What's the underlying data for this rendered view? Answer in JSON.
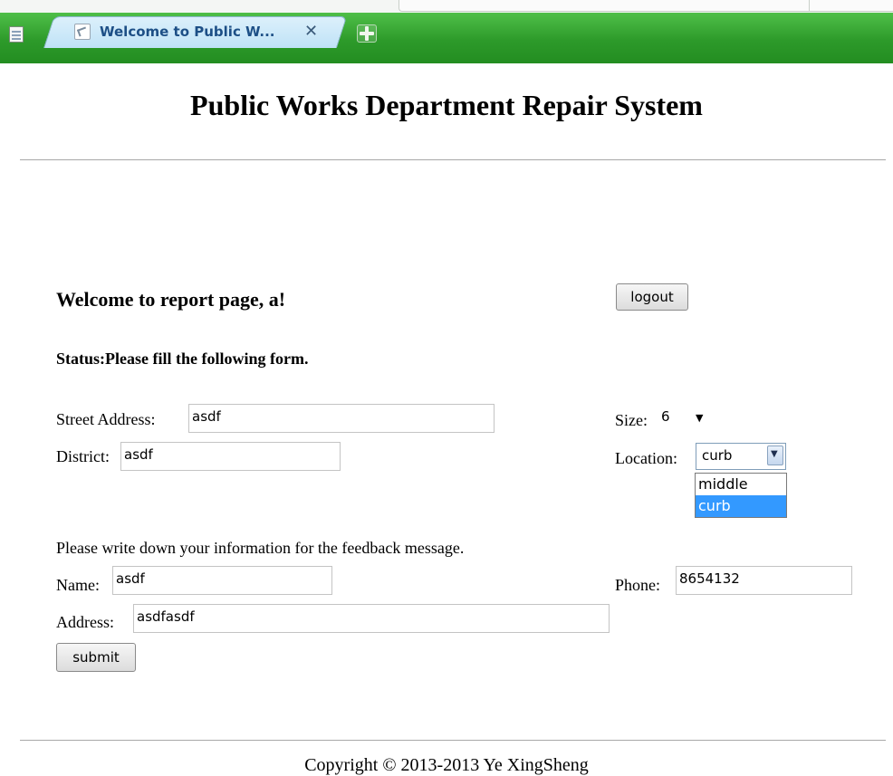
{
  "browser": {
    "tab_title": "Welcome to Public W...",
    "tab_close": "✕",
    "icons": [
      "menu-icon",
      "page-favicon-icon",
      "close-icon",
      "plus-icon"
    ]
  },
  "page": {
    "title": "Public Works Department Repair System",
    "welcome": "Welcome to report page, a!",
    "logout_label": "logout",
    "status": "Status:Please fill the following form.",
    "street_label": "Street Address:",
    "street_value": "asdf",
    "district_label": "District:",
    "district_value": "asdf",
    "size_label": "Size:",
    "size_value": "6",
    "location_label": "Location:",
    "location_value": "curb",
    "location_options": [
      "middle",
      "curb"
    ],
    "info_text": "Please write down your information for the feedback message.",
    "name_label": "Name:",
    "name_value": "asdf",
    "phone_label": "Phone:",
    "phone_value": "8654132",
    "address_label": "Address:",
    "address_value": "asdfasdf",
    "submit_label": "submit",
    "copyright": "Copyright © 2013-2013 Ye XingSheng"
  },
  "colors": {
    "tab_bar": "#2d9a2a",
    "tab": "#c8e6f8",
    "tab_text": "#1d4f86",
    "selected_option": "#3399ff"
  }
}
